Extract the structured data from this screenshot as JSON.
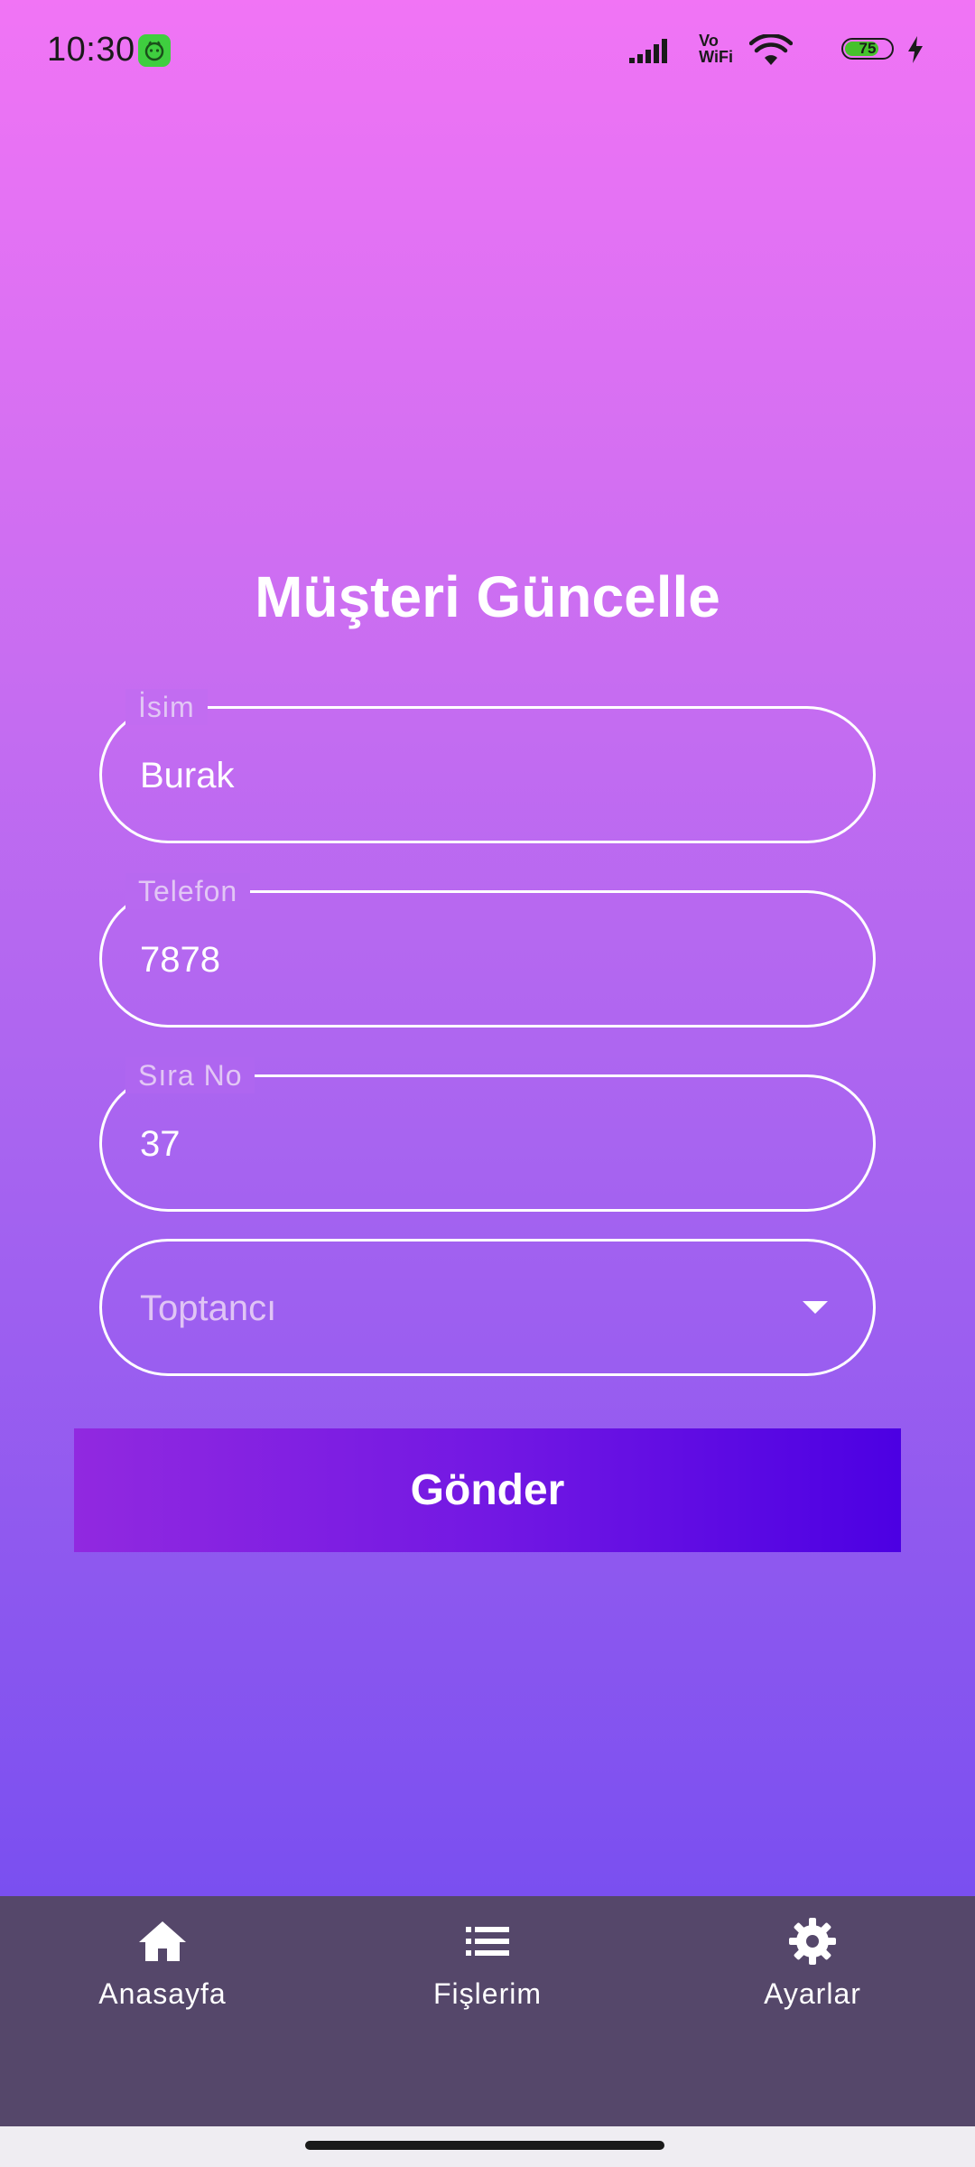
{
  "status_bar": {
    "time": "10:30",
    "network_label": "Vo\nWiFi",
    "battery_level": 75,
    "battery_label": "75"
  },
  "form": {
    "title": "Müşteri Güncelle",
    "fields": [
      {
        "label": "İsim",
        "value": "Burak"
      },
      {
        "label": "Telefon",
        "value": "7878"
      },
      {
        "label": "Sıra No",
        "value": "37"
      }
    ],
    "select": {
      "placeholder": "Toptancı"
    },
    "submit_label": "Gönder"
  },
  "bottom_nav": {
    "items": [
      {
        "label": "Anasayfa",
        "icon": "home-icon"
      },
      {
        "label": "Fişlerim",
        "icon": "list-icon"
      },
      {
        "label": "Ayarlar",
        "icon": "gear-icon"
      }
    ]
  },
  "colors": {
    "gradient_top": "#f174f5",
    "gradient_bottom": "#7a4ff0",
    "button_start": "#9129e0",
    "button_end": "#4c00e3",
    "nav_background": "#55476a",
    "battery_fill": "#46c22d"
  }
}
